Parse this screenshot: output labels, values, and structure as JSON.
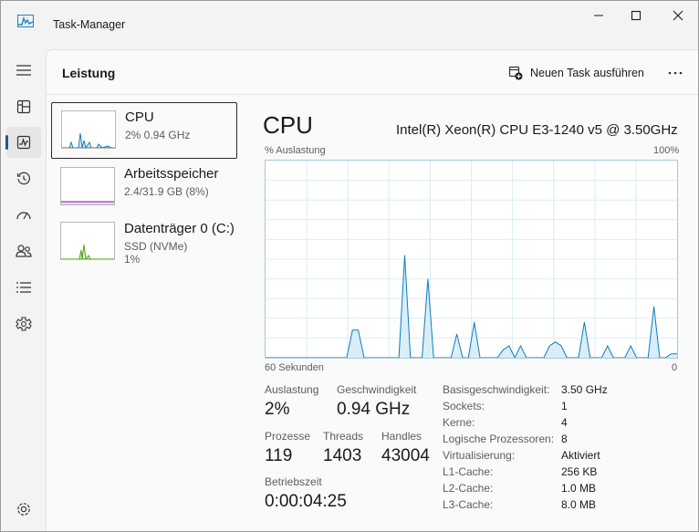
{
  "window": {
    "title": "Task-Manager",
    "accent": "#2f4f8a"
  },
  "rail": {
    "items": [
      {
        "icon": "hamburger-menu-icon"
      },
      {
        "icon": "processes-icon"
      },
      {
        "icon": "performance-icon",
        "active": true
      },
      {
        "icon": "app-history-icon"
      },
      {
        "icon": "startup-apps-icon"
      },
      {
        "icon": "users-icon"
      },
      {
        "icon": "details-icon"
      },
      {
        "icon": "services-icon"
      }
    ],
    "settings_icon": "settings-icon"
  },
  "header": {
    "title": "Leistung",
    "new_task_label": "Neuen Task ausführen"
  },
  "devices": [
    {
      "name": "CPU",
      "line1": "2%  0.94 GHz",
      "line2": ""
    },
    {
      "name": "Arbeitsspeicher",
      "line1": "2.4/31.9 GB (8%)",
      "line2": ""
    },
    {
      "name": "Datenträger 0 (C:)",
      "line1": "SSD (NVMe)",
      "line2": "1%"
    }
  ],
  "detail": {
    "title": "CPU",
    "model": "Intel(R) Xeon(R) CPU E3-1240 v5 @ 3.50GHz",
    "y_axis_label": "% Auslastung",
    "y_max_label": "100%",
    "x_left_label": "60 Sekunden",
    "x_right_label": "0",
    "graph_color": "#117dbb",
    "graph_fill": "#d9eef8",
    "stats": {
      "auslastung_label": "Auslastung",
      "auslastung_value": "2%",
      "geschwindigkeit_label": "Geschwindigkeit",
      "geschwindigkeit_value": "0.94 GHz",
      "prozesse_label": "Prozesse",
      "prozesse_value": "119",
      "threads_label": "Threads",
      "threads_value": "1403",
      "handles_label": "Handles",
      "handles_value": "43004",
      "betriebszeit_label": "Betriebszeit",
      "betriebszeit_value": "0:00:04:25"
    },
    "properties": [
      {
        "key": "Basisgeschwindigkeit:",
        "value": "3.50 GHz"
      },
      {
        "key": "Sockets:",
        "value": "1"
      },
      {
        "key": "Kerne:",
        "value": "4"
      },
      {
        "key": "Logische Prozessoren:",
        "value": "8"
      },
      {
        "key": "Virtualisierung:",
        "value": "Aktiviert"
      },
      {
        "key": "L1-Cache:",
        "value": "256 KB"
      },
      {
        "key": "L2-Cache:",
        "value": "1.0 MB"
      },
      {
        "key": "L3-Cache:",
        "value": "8.0 MB"
      }
    ]
  },
  "chart_data": {
    "type": "area",
    "x": [
      60,
      59,
      58,
      57,
      56,
      55,
      54,
      53,
      52,
      51,
      50,
      49,
      48,
      47,
      46,
      45,
      44,
      43,
      42,
      41,
      40,
      39,
      38,
      37,
      36,
      35,
      34,
      33,
      32,
      31,
      30,
      29,
      28,
      27,
      26,
      25,
      24,
      23,
      22,
      21,
      20,
      19,
      18,
      17,
      16,
      15,
      14,
      13,
      12,
      11,
      10,
      9,
      8,
      7,
      6,
      5,
      4,
      3,
      2,
      1,
      0
    ],
    "series": [
      {
        "values": [
          0,
          0,
          0,
          0,
          0,
          0,
          0,
          0,
          0,
          0,
          0,
          0,
          0,
          0,
          0,
          14,
          14,
          0,
          0,
          0,
          0,
          0,
          0,
          0,
          52,
          0,
          0,
          0,
          40,
          0,
          0,
          0,
          0,
          12,
          0,
          0,
          18,
          0,
          0,
          0,
          0,
          4,
          6,
          0,
          6,
          0,
          0,
          0,
          0,
          6,
          8,
          6,
          0,
          0,
          0,
          18,
          0,
          0,
          0,
          6,
          0,
          0,
          0,
          6,
          0,
          0,
          0,
          26,
          0,
          0,
          2,
          2
        ]
      }
    ],
    "xlabel": "60 Sekunden",
    "ylabel": "% Auslastung",
    "ylim": [
      0,
      100
    ],
    "grid": true
  }
}
